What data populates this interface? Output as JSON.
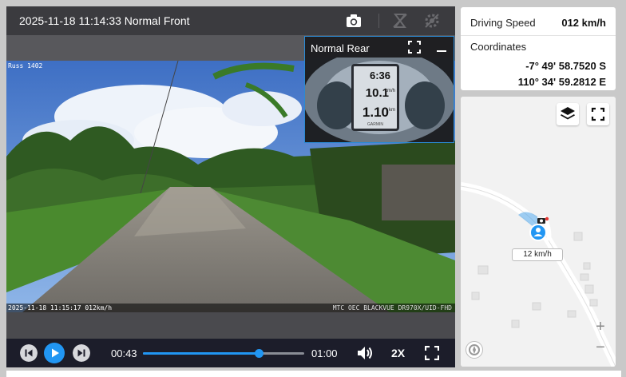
{
  "video": {
    "title": "2025-11-18 11:14:33 Normal Front",
    "icons": [
      "camera-icon",
      "snapshot-disabled-icon",
      "settings-disabled-icon"
    ],
    "camera_id": "Russ 1402",
    "overlay_timestamp": "2025-11-18 11:15:17 012km/h",
    "overlay_device": "MTC OEC BLACKVUE DR970X/UID-FHD"
  },
  "rear": {
    "title": "Normal Rear",
    "gauge_time": "6:36",
    "gauge_speed": "10.1",
    "gauge_speed_unit": "km/h",
    "gauge_dist": "1.10",
    "gauge_dist_unit": "km",
    "gauge_brand": "GARMIN"
  },
  "controls": {
    "current_time": "00:43",
    "total_time": "01:00",
    "progress": 0.72,
    "speed": "2X"
  },
  "info": {
    "speed_label": "Driving Speed",
    "speed_value": "012 km/h",
    "coords_label": "Coordinates",
    "lat": "-7° 49' 58.7520 S",
    "lon": "110° 34' 59.2812 E"
  },
  "map": {
    "vehicle_speed": "12 km/h",
    "zoom_in": "+",
    "zoom_out": "−"
  },
  "colors": {
    "accent": "#2196f3",
    "header": "#3b3b3f",
    "controls": "#1c1d2a"
  }
}
